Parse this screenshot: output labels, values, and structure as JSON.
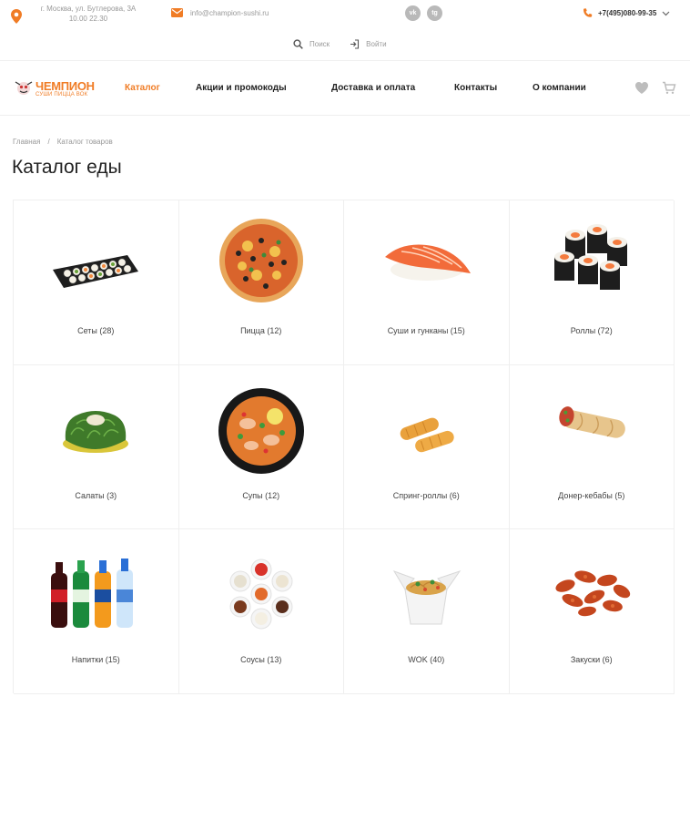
{
  "topbar": {
    "address_line1": "г. Москва, ул. Бутлерова, 3А",
    "address_line2": "10.00 22.30",
    "email": "info@champion-sushi.ru",
    "phone": "+7(495)080-99-35",
    "social": [
      {
        "icon": "vk-icon",
        "glyph": "vk"
      },
      {
        "icon": "telegram-icon",
        "glyph": "tg"
      }
    ]
  },
  "util": {
    "search_label": "Поиск",
    "login_label": "Войти"
  },
  "logo": {
    "name": "ЧЕМПИОН",
    "tagline": "СУШИ ПИЦЦА ВОК"
  },
  "nav": [
    {
      "label": "Каталог",
      "active": true
    },
    {
      "label": "Акции и промокоды",
      "active": false
    },
    {
      "label": "Доставка и оплата",
      "active": false
    },
    {
      "label": "Контакты",
      "active": false
    },
    {
      "label": "О компании",
      "active": false
    }
  ],
  "breadcrumb": {
    "home": "Главная",
    "separator": "/",
    "current": "Каталог товаров"
  },
  "page_title": "Каталог еды",
  "categories": [
    {
      "label": "Сеты (28)",
      "icon": "sushi-set-image"
    },
    {
      "label": "Пицца (12)",
      "icon": "pizza-image"
    },
    {
      "label": "Суши и гунканы (15)",
      "icon": "nigiri-image"
    },
    {
      "label": "Роллы (72)",
      "icon": "rolls-image"
    },
    {
      "label": "Салаты (3)",
      "icon": "salad-image"
    },
    {
      "label": "Супы (12)",
      "icon": "soup-image"
    },
    {
      "label": "Спринг-роллы (6)",
      "icon": "spring-rolls-image"
    },
    {
      "label": "Донер-кебабы (5)",
      "icon": "doner-image"
    },
    {
      "label": "Напитки (15)",
      "icon": "drinks-image"
    },
    {
      "label": "Соусы (13)",
      "icon": "sauces-image"
    },
    {
      "label": "WOK (40)",
      "icon": "wok-image"
    },
    {
      "label": "Закуски (6)",
      "icon": "wings-image"
    }
  ],
  "colors": {
    "accent": "#f07c25",
    "text": "#222222",
    "muted": "#999999",
    "border": "#efefef"
  }
}
